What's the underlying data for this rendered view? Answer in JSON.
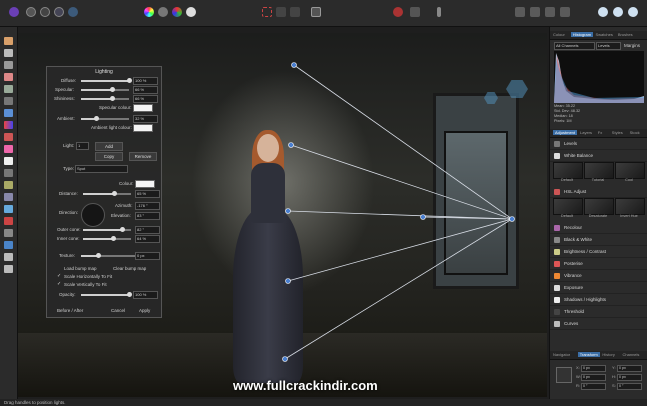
{
  "colors": {
    "accent": "#3b6ea6",
    "panel_bg": "#2b2b2b",
    "light_line": "#d8dde6"
  },
  "lighting": {
    "title": "Lighting",
    "diffuse": {
      "label": "Diffuse:",
      "value": "100 %",
      "level": 1.0
    },
    "specular": {
      "label": "Specular:",
      "value": "66 %",
      "level": 0.66
    },
    "shininess": {
      "label": "Shininess:",
      "value": "66 %",
      "level": 0.66
    },
    "specular_colour_label": "Specular colour:",
    "ambient": {
      "label": "Ambient:",
      "value": "32 %",
      "level": 0.32
    },
    "ambient_colour_label": "Ambient light colour:",
    "light_label": "Light:",
    "light_index": "1",
    "add_label": "Add",
    "copy_label": "Copy",
    "remove_label": "Remove",
    "type_label": "Type:",
    "type_value": "Spot",
    "colour_label": "Colour:",
    "distance": {
      "label": "Distance:",
      "value": "65 %",
      "level": 0.65
    },
    "direction_label": "Direction:",
    "azimuth_label": "Azimuth:",
    "azimuth_value": "-176 °",
    "elevation_label": "Elevation:",
    "elevation_value": "83 °",
    "outer_cone": {
      "label": "Outer cone:",
      "value": "82 °",
      "level": 0.82
    },
    "inner_cone": {
      "label": "Inner cone:",
      "value": "64 %",
      "level": 0.64
    },
    "texture": {
      "label": "Texture:",
      "value": "0 px",
      "level": 0.3
    },
    "load_bump_map": "Load bump map",
    "clear_bump_map": "Clear bump map",
    "scale_h": "Scale Horizontally To Fit",
    "scale_v": "Scale Vertically To Fit",
    "opacity": {
      "label": "Opacity:",
      "value": "100 %",
      "level": 1.0
    },
    "before_after": "Before / After",
    "cancel": "Cancel",
    "apply": "Apply"
  },
  "right_panel": {
    "top_tabs": [
      "Colour",
      "Histogram",
      "Swatches",
      "Brushes"
    ],
    "active_top_tab": 1,
    "channels_select": "All Channels",
    "levels_select": "Levels",
    "margins_label": "Margins",
    "hist_stats": [
      "Mean: 35.22",
      "Std. Dev: 48.32",
      "Median: 18",
      "Pixels: 1M"
    ],
    "mid_tabs": [
      "Adjustment",
      "Layers",
      "Fx",
      "Styles",
      "Stock"
    ],
    "active_mid_tab": 0,
    "adjustments": [
      "Levels",
      "White Balance",
      "HSL Adjust",
      "Recolour",
      "Black & White",
      "Brightness / Contrast",
      "Posterise",
      "Vibrance",
      "Exposure",
      "Shadows / Highlights",
      "Threshold",
      "Curves"
    ],
    "wb_presets": [
      "Default",
      "Tutorial",
      "Cool"
    ],
    "hsl_presets": [
      "Default",
      "Desaturate",
      "Invert Hue"
    ],
    "bottom_tabs": [
      "Navigator",
      "Transform",
      "History",
      "Channels"
    ],
    "active_bottom_tab": 1,
    "transform_fields": [
      "X:",
      "0 px",
      "Y:",
      "0 px",
      "W:",
      "0 px",
      "H:",
      "0 px",
      "R:",
      "0 °",
      "S:",
      "0 °"
    ]
  },
  "status_bar": {
    "text": "Drag handles to position lights."
  },
  "watermark": "www.fullcrackindir.com"
}
